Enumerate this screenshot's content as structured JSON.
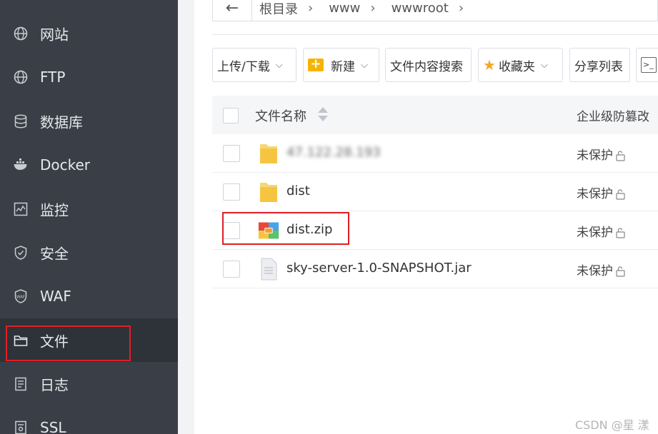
{
  "sidebar": {
    "items": [
      {
        "label": "网站",
        "icon": "globe-icon"
      },
      {
        "label": "FTP",
        "icon": "globe-icon"
      },
      {
        "label": "数据库",
        "icon": "database-icon"
      },
      {
        "label": "Docker",
        "icon": "docker-icon"
      },
      {
        "label": "监控",
        "icon": "monitor-icon"
      },
      {
        "label": "安全",
        "icon": "shield-icon"
      },
      {
        "label": "WAF",
        "icon": "waf-shield-icon"
      },
      {
        "label": "文件",
        "icon": "folder-icon",
        "active": true
      },
      {
        "label": "日志",
        "icon": "log-icon"
      },
      {
        "label": "SSL",
        "icon": "ssl-icon"
      }
    ]
  },
  "breadcrumb": {
    "back_glyph": "←",
    "items": [
      "根目录",
      "www",
      "wwwroot"
    ],
    "separator": "›"
  },
  "toolbar": {
    "upload_label": "上传/下载",
    "new_label": "新建",
    "search_label": "文件内容搜索",
    "favorites_label": "收藏夹",
    "share_label": "分享列表",
    "terminal_glyph": ">_",
    "chevron": "⌵"
  },
  "table": {
    "col_name": "文件名称",
    "col_protect": "企业级防篡改",
    "rows": [
      {
        "name": "47.122.28.193",
        "type": "folder",
        "status": "未保护",
        "blurred": true
      },
      {
        "name": "dist",
        "type": "folder",
        "status": "未保护"
      },
      {
        "name": "dist.zip",
        "type": "zip",
        "status": "未保护"
      },
      {
        "name": "sky-server-1.0-SNAPSHOT.jar",
        "type": "file",
        "status": "未保护"
      }
    ]
  },
  "watermark": "CSDN @星  漾",
  "colors": {
    "sidebar_bg": "#3a3f47",
    "highlight_red": "#e01e24",
    "folder_yellow": "#f5c542"
  }
}
